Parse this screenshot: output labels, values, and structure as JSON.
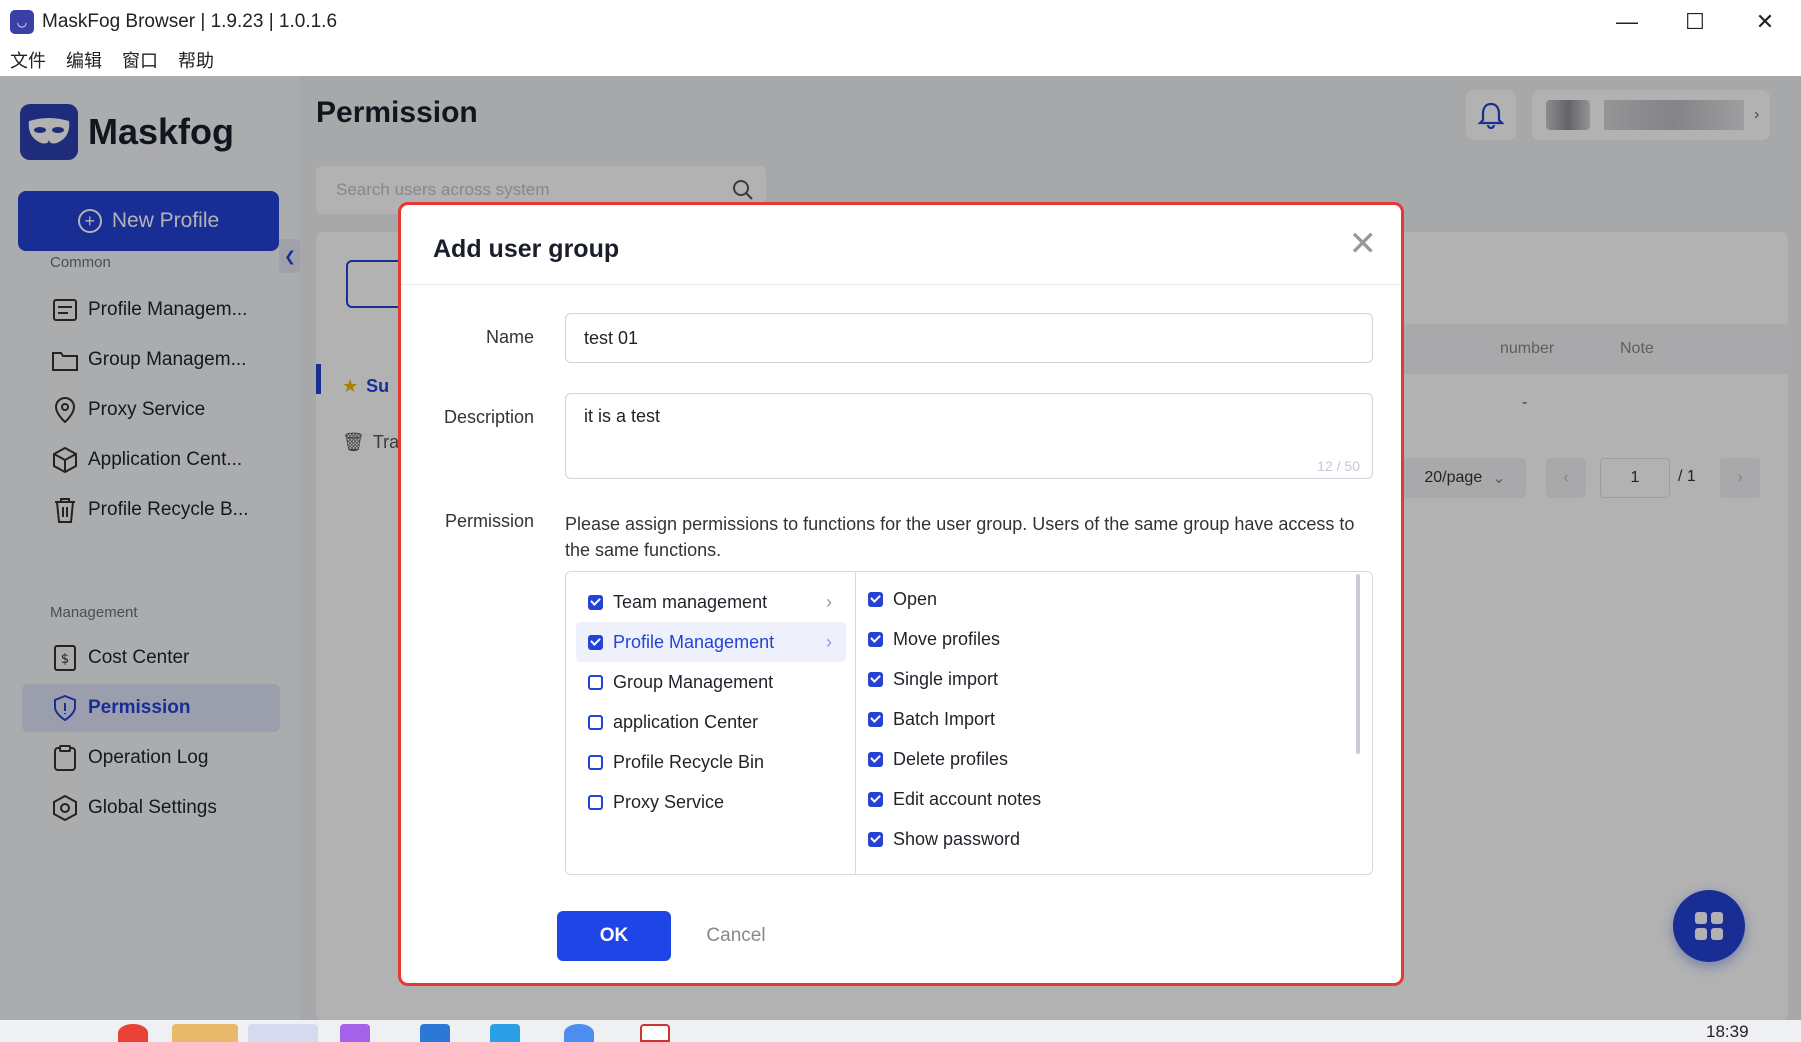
{
  "window": {
    "title": "MaskFog Browser | 1.9.23 | 1.0.1.6",
    "menu": [
      "文件",
      "编辑",
      "窗口",
      "帮助"
    ]
  },
  "sidebar": {
    "brand": "Maskfog",
    "new_profile": "New Profile",
    "common_label": "Common",
    "common_items": [
      {
        "label": "Profile Managem...",
        "icon": "profile-icon"
      },
      {
        "label": "Group Managem...",
        "icon": "folder-icon"
      },
      {
        "label": "Proxy Service",
        "icon": "location-icon"
      },
      {
        "label": "Application Cent...",
        "icon": "cube-icon"
      },
      {
        "label": "Profile Recycle B...",
        "icon": "trash-icon"
      }
    ],
    "management_label": "Management",
    "management_items": [
      {
        "label": "Cost Center",
        "icon": "receipt-icon"
      },
      {
        "label": "Permission",
        "icon": "shield-icon",
        "active": true
      },
      {
        "label": "Operation Log",
        "icon": "clipboard-icon"
      },
      {
        "label": "Global Settings",
        "icon": "settings-icon"
      }
    ]
  },
  "main": {
    "title": "Permission",
    "search_placeholder": "Search users across system",
    "list_a": "Su",
    "list_b": "Tra",
    "table_headers": [
      "number",
      "Note"
    ],
    "table_cell": "-",
    "page_size": "20/page",
    "current_page": "1",
    "total_pages": "/ 1"
  },
  "dialog": {
    "title": "Add user group",
    "name_label": "Name",
    "name_value": "test 01",
    "description_label": "Description",
    "description_value": "it is a test",
    "description_counter": "12 / 50",
    "permission_label": "Permission",
    "permission_description": "Please assign permissions to functions for the user group. Users of the same group have access to the same functions.",
    "modules": [
      {
        "label": "Team management",
        "checked": true,
        "arrow": true
      },
      {
        "label": "Profile Management",
        "checked": true,
        "arrow": true,
        "selected": true
      },
      {
        "label": "Group Management",
        "checked": false
      },
      {
        "label": "application Center",
        "checked": false
      },
      {
        "label": "Profile Recycle Bin",
        "checked": false
      },
      {
        "label": "Proxy Service",
        "checked": false
      }
    ],
    "functions": [
      {
        "label": "Open",
        "checked": true
      },
      {
        "label": "Move profiles",
        "checked": true
      },
      {
        "label": "Single import",
        "checked": true
      },
      {
        "label": "Batch Import",
        "checked": true
      },
      {
        "label": "Delete profiles",
        "checked": true
      },
      {
        "label": "Edit account notes",
        "checked": true
      },
      {
        "label": "Show password",
        "checked": true
      }
    ],
    "ok": "OK",
    "cancel": "Cancel"
  },
  "taskbar": {
    "time": "18:39"
  },
  "colors": {
    "accent": "#2343d6",
    "highlight_border": "#e53935"
  }
}
